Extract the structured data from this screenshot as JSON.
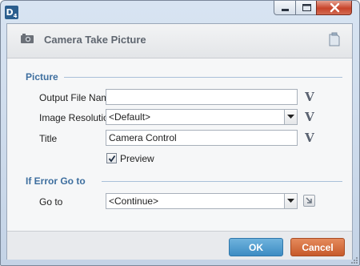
{
  "window": {
    "logo_text": "D",
    "minimize_icon": "minimize-icon",
    "maximize_icon": "maximize-icon",
    "close_icon": "close-icon"
  },
  "header": {
    "title": "Camera Take Picture",
    "icon": "camera-icon",
    "note_icon": "note-icon"
  },
  "picture_section": {
    "label": "Picture",
    "output_file_name": {
      "label": "Output File Name",
      "value": ""
    },
    "image_resolution": {
      "label": "Image Resolution",
      "value": "<Default>"
    },
    "title": {
      "label": "Title",
      "value": "Camera Control"
    },
    "preview": {
      "label": "Preview",
      "checked": true
    },
    "variable_button_label": "V"
  },
  "error_section": {
    "label": "If Error Go to",
    "go_to": {
      "label": "Go to",
      "value": "<Continue>"
    }
  },
  "footer": {
    "ok_label": "OK",
    "cancel_label": "Cancel"
  },
  "colors": {
    "section_label": "#3e6f9f",
    "ok_button": "#3d8cc3",
    "cancel_button": "#c75a2a",
    "close_button": "#c7432a"
  }
}
